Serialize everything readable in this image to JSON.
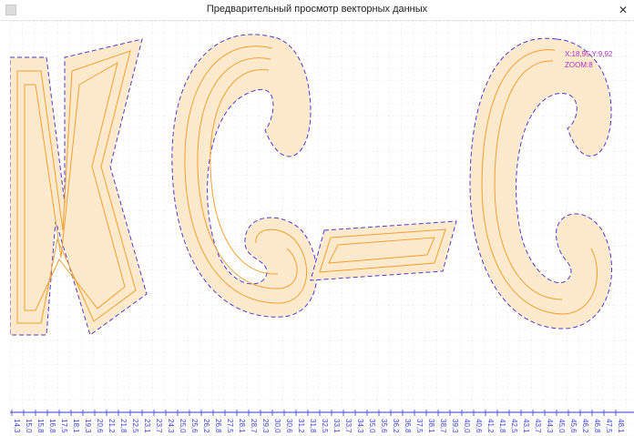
{
  "window": {
    "title": "Предварительный просмотр векторных данных",
    "close_glyph": "✕"
  },
  "readout": {
    "coords": "X:18,95 Y:9,92",
    "zoom": "ZOOM:8"
  },
  "axis": {
    "labels": [
      "14,3",
      "15,0",
      "15,8",
      "16,8",
      "17,5",
      "18,1",
      "19,3",
      "20,6",
      "21,2",
      "21,8",
      "22,5",
      "23,1",
      "23,7",
      "24,3",
      "25,0",
      "25,6",
      "26,2",
      "26,8",
      "27,5",
      "28,1",
      "28,7",
      "29,3",
      "30,0",
      "30,6",
      "31,2",
      "31,8",
      "32,5",
      "33,1",
      "33,7",
      "34,3",
      "35,0",
      "35,6",
      "36,2",
      "36,8",
      "37,5",
      "38,1",
      "38,7",
      "39,3",
      "40,0",
      "40,6",
      "41,2",
      "41,8",
      "42,5",
      "43,1",
      "43,7",
      "44,3",
      "45,0",
      "45,6",
      "46,2",
      "46,8",
      "47,5",
      "48,1"
    ],
    "color": "#3b3fd6"
  },
  "colors": {
    "toolpath": "#f0a030",
    "contour": "#4a3ecf",
    "grid": "#d8d8e4",
    "readout": "#b030c0"
  },
  "icons": {
    "app": "app-icon",
    "close": "close-icon"
  }
}
